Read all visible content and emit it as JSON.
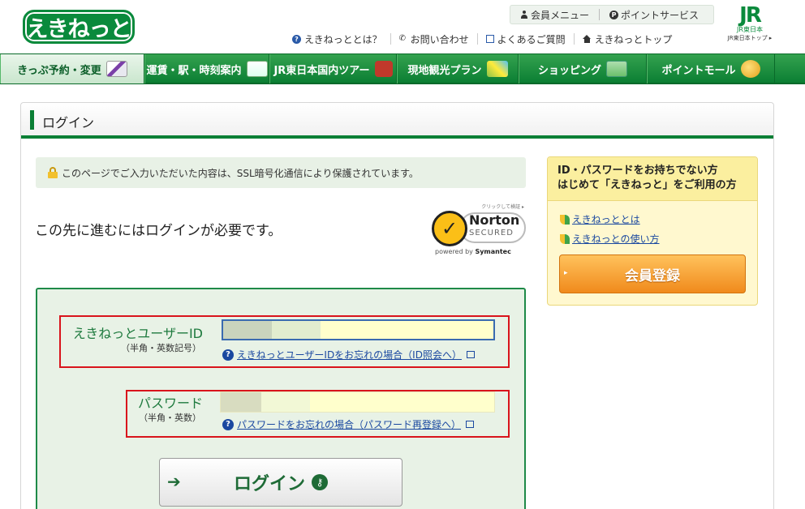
{
  "header": {
    "logo_text": "えきねっと",
    "member_menu": "会員メニュー",
    "point_service": "ポイントサービス",
    "jr_mark": "JR",
    "jr_sub": "JR東日本",
    "jr_top": "JR東日本トップ ▸",
    "links": [
      {
        "label": "えきねっととは？"
      },
      {
        "label": "お問い合わせ"
      },
      {
        "label": "よくあるご質問"
      },
      {
        "label": "えきねっとトップ"
      }
    ]
  },
  "nav": {
    "items": [
      {
        "label": "きっぷ予約・変更"
      },
      {
        "label": "運賃・駅・時刻案内"
      },
      {
        "label": "JR東日本国内ツアー"
      },
      {
        "label": "現地観光プラン"
      },
      {
        "label": "ショッピング"
      },
      {
        "label": "ポイントモール"
      }
    ]
  },
  "panel": {
    "title": "ログイン",
    "ssl_notice": "このページでご入力いただいた内容は、SSL暗号化通信により保護されています。",
    "need_login": "この先に進むにはログインが必要です。"
  },
  "norton": {
    "click": "クリックして検証 ▸",
    "name": "Norton",
    "secured": "SECURED",
    "powered_prefix": "powered by",
    "powered_brand": "Symantec",
    "check": "✓"
  },
  "form": {
    "id_label": "えきねっとユーザーID",
    "id_sub": "（半角・英数記号）",
    "id_value": "",
    "id_help": "えきねっとユーザーIDをお忘れの場合（ID照会へ）",
    "pw_label": "パスワード",
    "pw_sub": "（半角・英数）",
    "pw_value": "",
    "pw_help": "パスワードをお忘れの場合（パスワード再登録へ）",
    "login_button": "ログイン",
    "help_icon": "?",
    "arrow": "➔",
    "key_icon": "⚷"
  },
  "register": {
    "heading_line1": "ID・パスワードをお持ちでない方",
    "heading_line2": "はじめて「えきねっと」をご利用の方",
    "link1": "えきねっととは",
    "link2": "えきねっとの使い方",
    "button": "会員登録",
    "arrow": "▸"
  },
  "colors": {
    "brand_green": "#0a7f35",
    "highlight_red": "#d9141c",
    "link_blue": "#1a48a0",
    "register_orange": "#f08a1c"
  }
}
